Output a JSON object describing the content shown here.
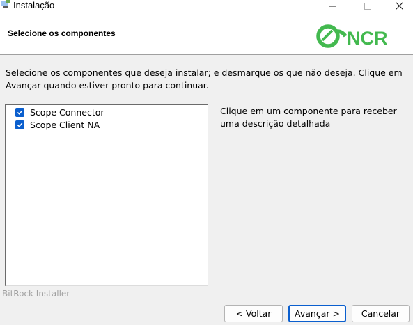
{
  "window": {
    "title": "Instalação"
  },
  "header": {
    "title": "Selecione os componentes",
    "logo_text": "NCR"
  },
  "main": {
    "instruction": "Selecione os componentes que deseja instalar; e desmarque os que não deseja. Clique em Avançar quando estiver pronto para continuar.",
    "components": [
      {
        "label": "Scope Connector",
        "checked": true
      },
      {
        "label": "Scope Client NA",
        "checked": true
      }
    ],
    "description": "Clique em um componente para receber uma descrição detalhada"
  },
  "footer": {
    "brand": "BitRock Installer",
    "back_label": "< Voltar",
    "next_label": "Avançar >",
    "cancel_label": "Cancelar"
  },
  "colors": {
    "accent": "#0b5fce",
    "logo_green": "#43b94f"
  },
  "icons": {
    "app": "installer-app-icon",
    "minimize": "minimize-icon",
    "maximize": "maximize-icon",
    "close": "close-icon",
    "check": "checkmark-icon"
  }
}
